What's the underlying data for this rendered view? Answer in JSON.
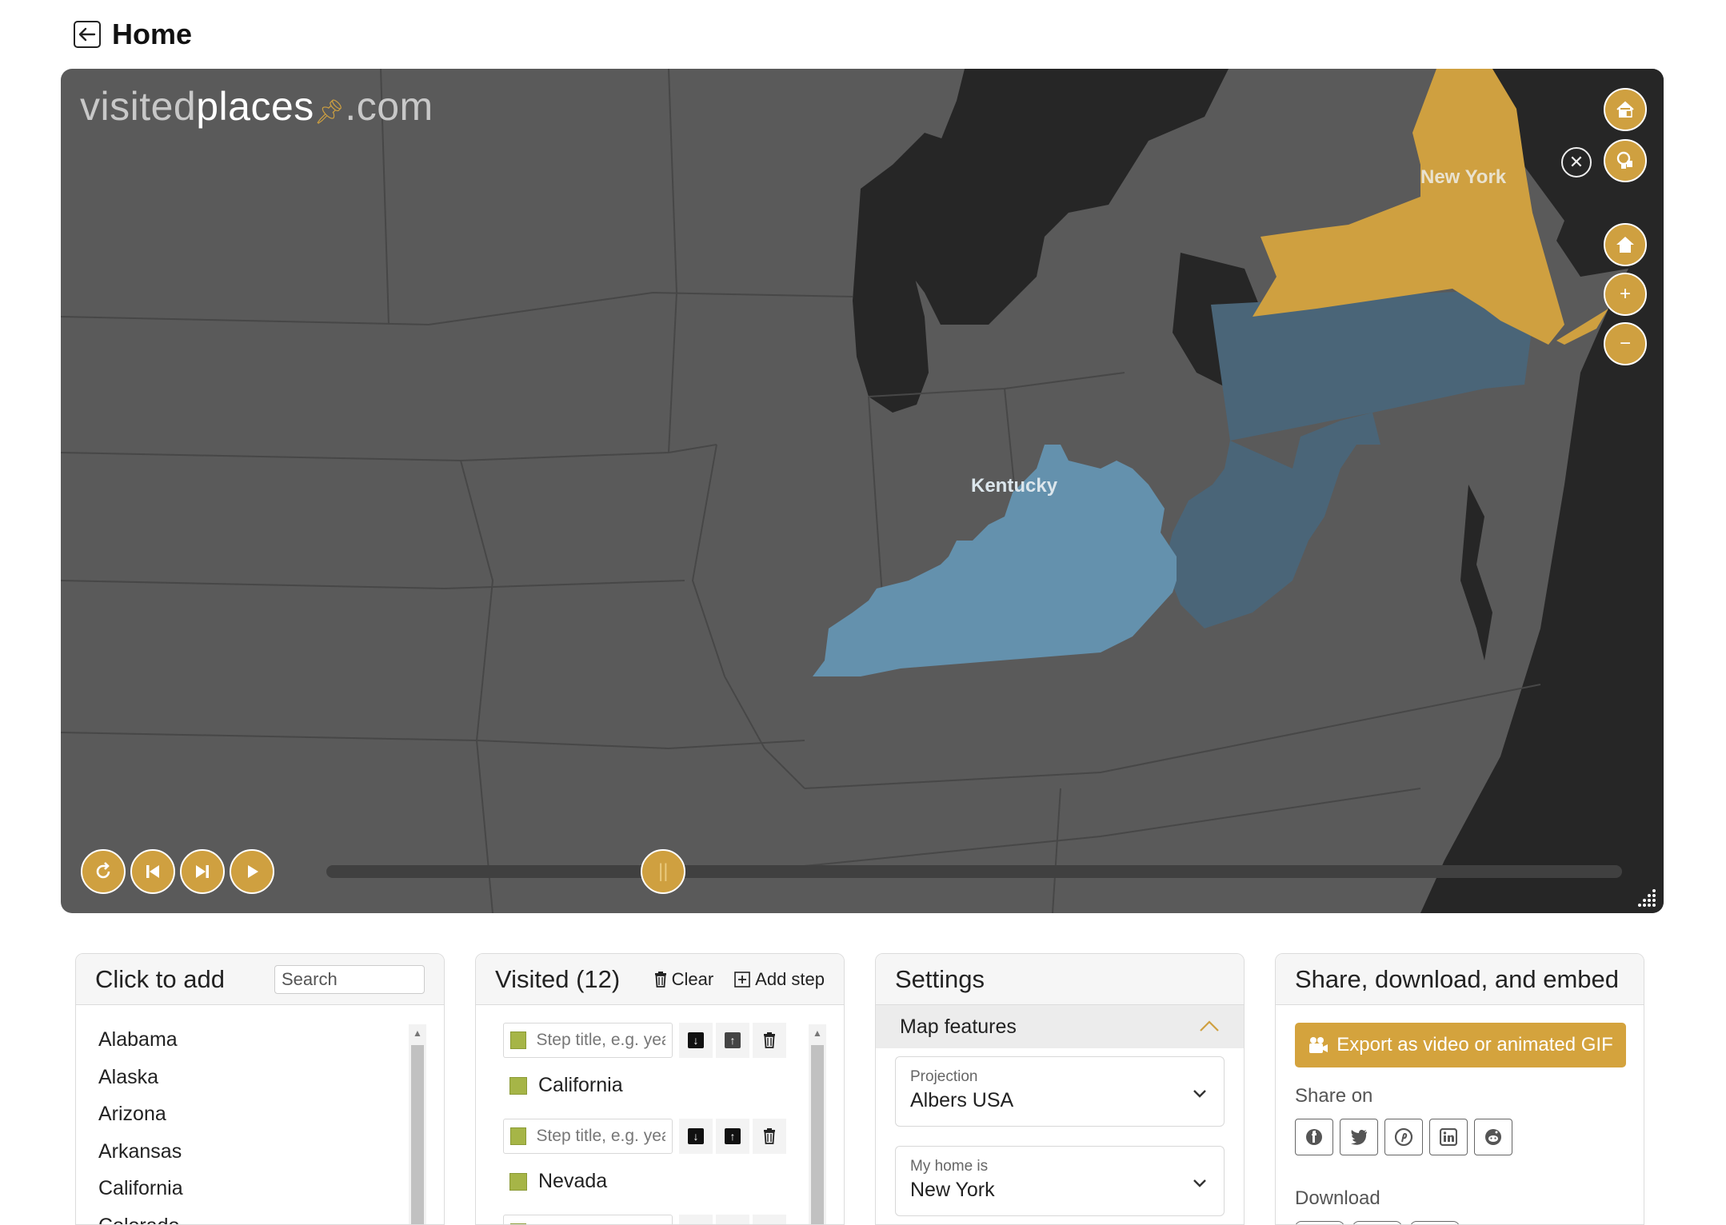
{
  "header": {
    "title": "Home"
  },
  "map": {
    "logo": {
      "part1": "visited",
      "part2": "places",
      "part3": ".com"
    },
    "labels": {
      "new_york": "New York",
      "kentucky": "Kentucky"
    },
    "colors": {
      "new_york": "#cfa040",
      "kentucky": "#6491ad",
      "pennsylvania_wv": "#4a6578",
      "land": "#5a5a5a",
      "water": "#262626",
      "accent": "#cfa040"
    },
    "timeline_position": 0.26
  },
  "click_to_add": {
    "title": "Click to add",
    "search_placeholder": "Search",
    "items": [
      "Alabama",
      "Alaska",
      "Arizona",
      "Arkansas",
      "California",
      "Colorado"
    ]
  },
  "visited": {
    "title": "Visited (12)",
    "clear_label": "Clear",
    "add_step_label": "Add step",
    "step_placeholder": "Step title, e.g. year",
    "places": [
      "California",
      "Nevada"
    ]
  },
  "settings": {
    "title": "Settings",
    "section": "Map features",
    "projection_label": "Projection",
    "projection_value": "Albers USA",
    "home_label": "My home is",
    "home_value": "New York"
  },
  "share": {
    "title": "Share, download, and embed",
    "export_label": "Export as video or animated GIF",
    "share_on_label": "Share on",
    "download_label": "Download"
  }
}
